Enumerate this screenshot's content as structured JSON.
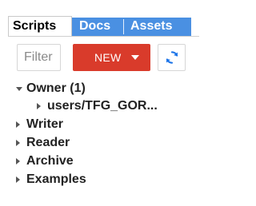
{
  "tabs": [
    {
      "label": "Scripts",
      "active": true
    },
    {
      "label": "Docs",
      "active": false
    },
    {
      "label": "Assets",
      "active": false
    }
  ],
  "toolbar": {
    "filter_placeholder": "Filter",
    "new_label": "NEW",
    "new_icon": "caret-down-icon",
    "refresh_icon": "refresh-icon"
  },
  "tree": {
    "owner": {
      "label": "Owner (1)",
      "expanded": true
    },
    "owner_child": {
      "label": "users/TFG_GOR...",
      "expanded": false
    },
    "writer": {
      "label": "Writer",
      "expanded": false
    },
    "reader": {
      "label": "Reader",
      "expanded": false
    },
    "archive": {
      "label": "Archive",
      "expanded": false
    },
    "examples": {
      "label": "Examples",
      "expanded": false
    }
  },
  "colors": {
    "tab_bar": "#4a90e2",
    "new_button": "#d93b2b",
    "refresh_icon": "#1a73e8"
  }
}
